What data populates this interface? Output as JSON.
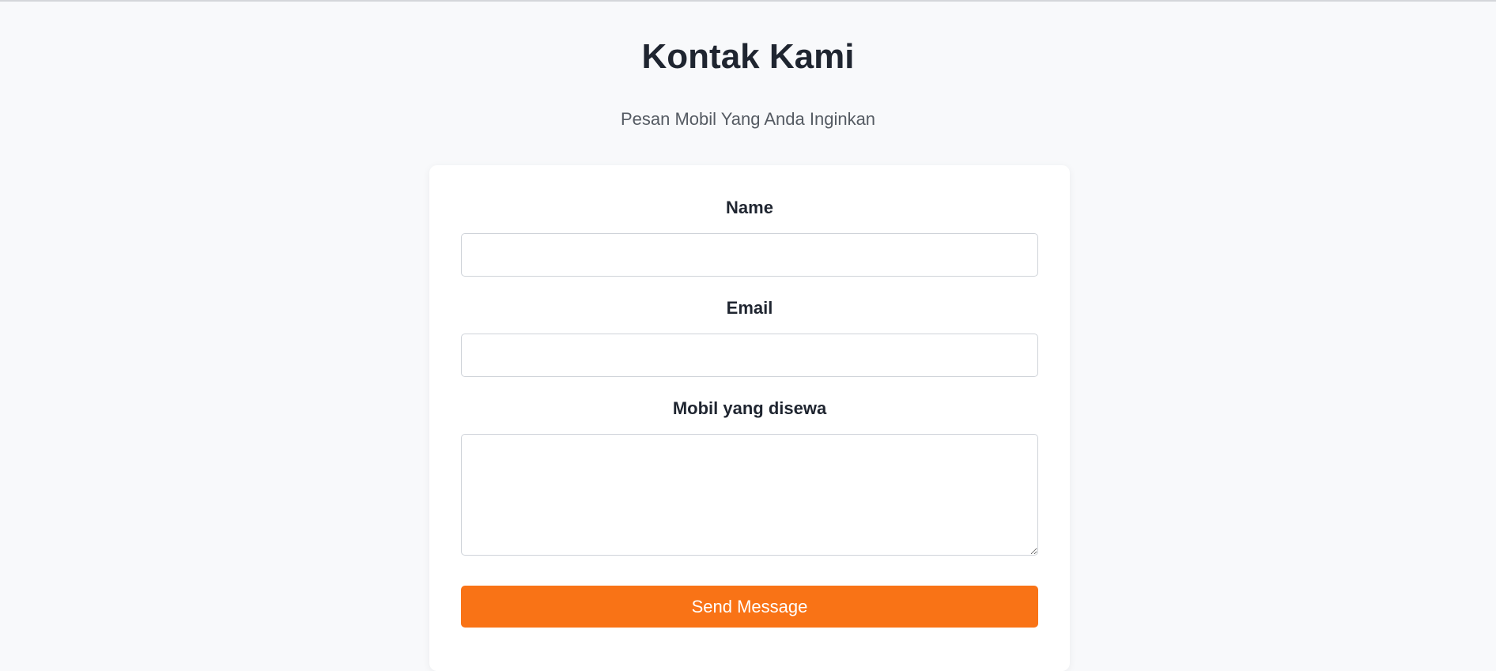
{
  "page": {
    "title": "Kontak Kami",
    "subtitle": "Pesan Mobil Yang Anda Inginkan"
  },
  "form": {
    "name": {
      "label": "Name",
      "value": "",
      "placeholder": ""
    },
    "email": {
      "label": "Email",
      "value": "",
      "placeholder": ""
    },
    "car": {
      "label": "Mobil yang disewa",
      "value": "",
      "placeholder": ""
    },
    "submit_label": "Send Message"
  },
  "colors": {
    "accent": "#f97316",
    "background": "#f8f9fb",
    "card": "#ffffff",
    "text": "#1f2530"
  }
}
